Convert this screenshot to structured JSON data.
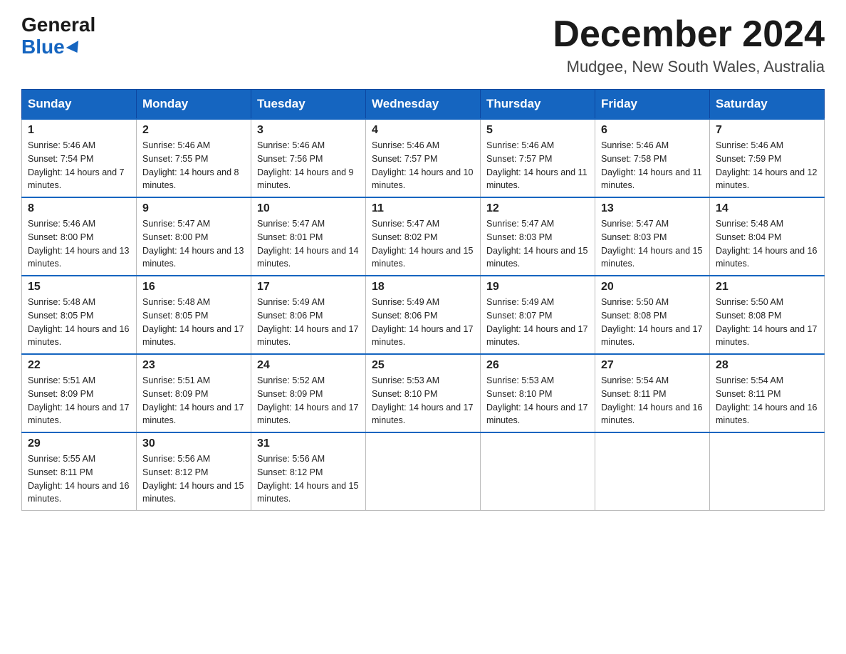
{
  "logo": {
    "general": "General",
    "blue": "Blue"
  },
  "header": {
    "month": "December 2024",
    "location": "Mudgee, New South Wales, Australia"
  },
  "weekdays": [
    "Sunday",
    "Monday",
    "Tuesday",
    "Wednesday",
    "Thursday",
    "Friday",
    "Saturday"
  ],
  "weeks": [
    [
      {
        "day": "1",
        "sunrise": "5:46 AM",
        "sunset": "7:54 PM",
        "daylight": "14 hours and 7 minutes."
      },
      {
        "day": "2",
        "sunrise": "5:46 AM",
        "sunset": "7:55 PM",
        "daylight": "14 hours and 8 minutes."
      },
      {
        "day": "3",
        "sunrise": "5:46 AM",
        "sunset": "7:56 PM",
        "daylight": "14 hours and 9 minutes."
      },
      {
        "day": "4",
        "sunrise": "5:46 AM",
        "sunset": "7:57 PM",
        "daylight": "14 hours and 10 minutes."
      },
      {
        "day": "5",
        "sunrise": "5:46 AM",
        "sunset": "7:57 PM",
        "daylight": "14 hours and 11 minutes."
      },
      {
        "day": "6",
        "sunrise": "5:46 AM",
        "sunset": "7:58 PM",
        "daylight": "14 hours and 11 minutes."
      },
      {
        "day": "7",
        "sunrise": "5:46 AM",
        "sunset": "7:59 PM",
        "daylight": "14 hours and 12 minutes."
      }
    ],
    [
      {
        "day": "8",
        "sunrise": "5:46 AM",
        "sunset": "8:00 PM",
        "daylight": "14 hours and 13 minutes."
      },
      {
        "day": "9",
        "sunrise": "5:47 AM",
        "sunset": "8:00 PM",
        "daylight": "14 hours and 13 minutes."
      },
      {
        "day": "10",
        "sunrise": "5:47 AM",
        "sunset": "8:01 PM",
        "daylight": "14 hours and 14 minutes."
      },
      {
        "day": "11",
        "sunrise": "5:47 AM",
        "sunset": "8:02 PM",
        "daylight": "14 hours and 15 minutes."
      },
      {
        "day": "12",
        "sunrise": "5:47 AM",
        "sunset": "8:03 PM",
        "daylight": "14 hours and 15 minutes."
      },
      {
        "day": "13",
        "sunrise": "5:47 AM",
        "sunset": "8:03 PM",
        "daylight": "14 hours and 15 minutes."
      },
      {
        "day": "14",
        "sunrise": "5:48 AM",
        "sunset": "8:04 PM",
        "daylight": "14 hours and 16 minutes."
      }
    ],
    [
      {
        "day": "15",
        "sunrise": "5:48 AM",
        "sunset": "8:05 PM",
        "daylight": "14 hours and 16 minutes."
      },
      {
        "day": "16",
        "sunrise": "5:48 AM",
        "sunset": "8:05 PM",
        "daylight": "14 hours and 17 minutes."
      },
      {
        "day": "17",
        "sunrise": "5:49 AM",
        "sunset": "8:06 PM",
        "daylight": "14 hours and 17 minutes."
      },
      {
        "day": "18",
        "sunrise": "5:49 AM",
        "sunset": "8:06 PM",
        "daylight": "14 hours and 17 minutes."
      },
      {
        "day": "19",
        "sunrise": "5:49 AM",
        "sunset": "8:07 PM",
        "daylight": "14 hours and 17 minutes."
      },
      {
        "day": "20",
        "sunrise": "5:50 AM",
        "sunset": "8:08 PM",
        "daylight": "14 hours and 17 minutes."
      },
      {
        "day": "21",
        "sunrise": "5:50 AM",
        "sunset": "8:08 PM",
        "daylight": "14 hours and 17 minutes."
      }
    ],
    [
      {
        "day": "22",
        "sunrise": "5:51 AM",
        "sunset": "8:09 PM",
        "daylight": "14 hours and 17 minutes."
      },
      {
        "day": "23",
        "sunrise": "5:51 AM",
        "sunset": "8:09 PM",
        "daylight": "14 hours and 17 minutes."
      },
      {
        "day": "24",
        "sunrise": "5:52 AM",
        "sunset": "8:09 PM",
        "daylight": "14 hours and 17 minutes."
      },
      {
        "day": "25",
        "sunrise": "5:53 AM",
        "sunset": "8:10 PM",
        "daylight": "14 hours and 17 minutes."
      },
      {
        "day": "26",
        "sunrise": "5:53 AM",
        "sunset": "8:10 PM",
        "daylight": "14 hours and 17 minutes."
      },
      {
        "day": "27",
        "sunrise": "5:54 AM",
        "sunset": "8:11 PM",
        "daylight": "14 hours and 16 minutes."
      },
      {
        "day": "28",
        "sunrise": "5:54 AM",
        "sunset": "8:11 PM",
        "daylight": "14 hours and 16 minutes."
      }
    ],
    [
      {
        "day": "29",
        "sunrise": "5:55 AM",
        "sunset": "8:11 PM",
        "daylight": "14 hours and 16 minutes."
      },
      {
        "day": "30",
        "sunrise": "5:56 AM",
        "sunset": "8:12 PM",
        "daylight": "14 hours and 15 minutes."
      },
      {
        "day": "31",
        "sunrise": "5:56 AM",
        "sunset": "8:12 PM",
        "daylight": "14 hours and 15 minutes."
      },
      null,
      null,
      null,
      null
    ]
  ]
}
